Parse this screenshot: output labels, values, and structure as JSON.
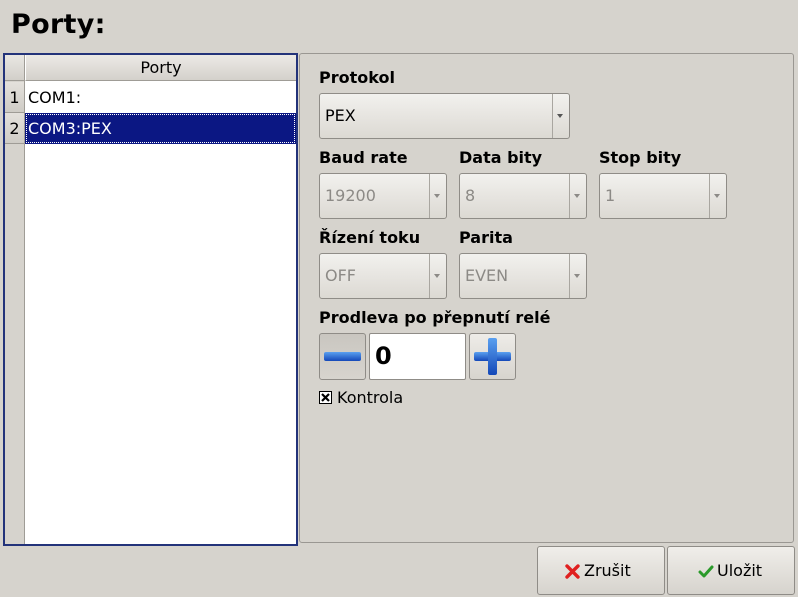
{
  "page": {
    "title": "Porty:"
  },
  "ports_table": {
    "header": "Porty",
    "rows": [
      {
        "num": "1",
        "label": "COM1:",
        "selected": false
      },
      {
        "num": "2",
        "label": "COM3:PEX",
        "selected": true
      }
    ]
  },
  "settings": {
    "protocol": {
      "label": "Protokol",
      "value": "PEX"
    },
    "baud_rate": {
      "label": "Baud rate",
      "value": "19200"
    },
    "data_bits": {
      "label": "Data bity",
      "value": "8"
    },
    "stop_bits": {
      "label": "Stop bity",
      "value": "1"
    },
    "flow_control": {
      "label": "Řízení toku",
      "value": "OFF"
    },
    "parity": {
      "label": "Parita",
      "value": "EVEN"
    },
    "relay_delay": {
      "label": "Prodleva po přepnutí relé",
      "value": "0"
    },
    "control_check": {
      "label": "Kontrola",
      "checked": true
    }
  },
  "actions": {
    "cancel_label": "Zrušit",
    "save_label": "Uložit"
  },
  "colors": {
    "selection": "#0b1783",
    "cancel_icon": "#e02020",
    "save_icon": "#2a9a2a",
    "stepper_icon": "#1e64d8"
  }
}
